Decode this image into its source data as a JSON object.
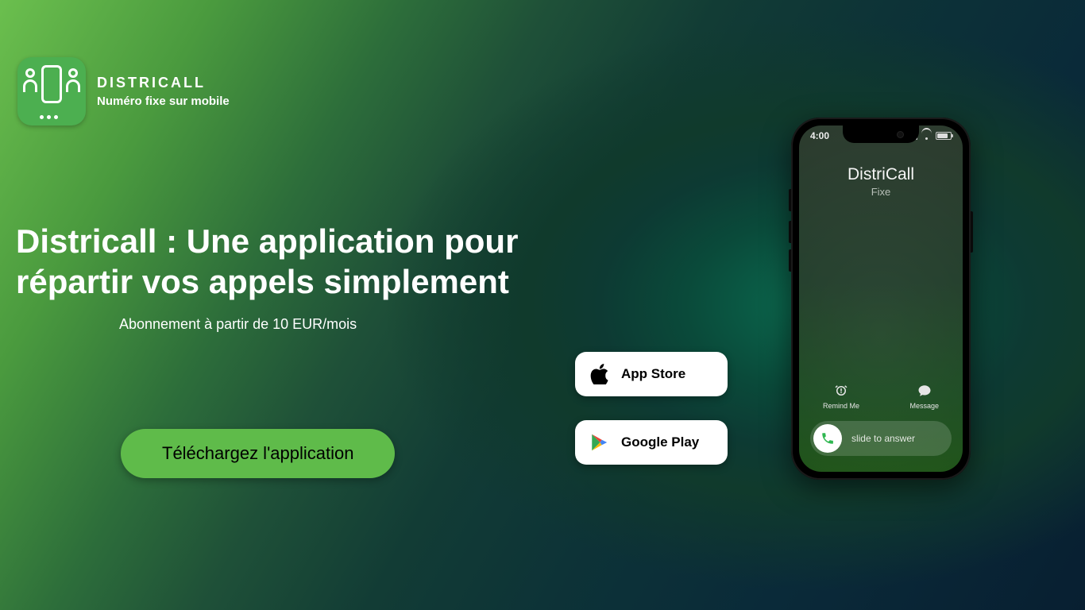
{
  "brand": {
    "name": "DISTRICALL",
    "tagline": "Numéro fixe sur mobile"
  },
  "hero": {
    "headline": "Districall : Une application pour répartir vos appels simplement",
    "subtitle": "Abonnement à partir de 10 EUR/mois",
    "cta": "Téléchargez l'application"
  },
  "stores": {
    "appstore": "App Store",
    "googleplay": "Google Play"
  },
  "phone": {
    "time": "4:00",
    "caller_name": "DistriCall",
    "caller_type": "Fixe",
    "remind": "Remind Me",
    "message": "Message",
    "slide": "slide to answer"
  }
}
